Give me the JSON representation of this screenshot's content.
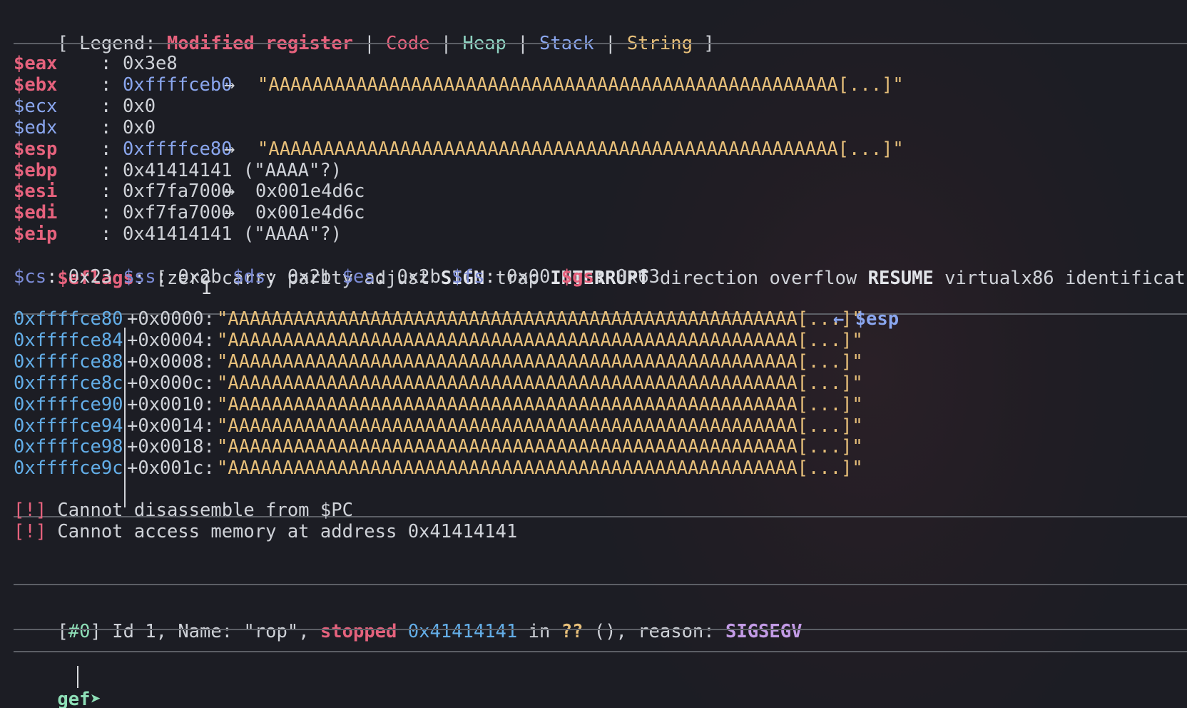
{
  "legend": {
    "open": "[ Legend: ",
    "modified": "Modified register",
    "sep": " | ",
    "code": "Code",
    "heap": "Heap",
    "stack": "Stack",
    "string": "String",
    "close": " ]"
  },
  "registers": [
    {
      "name": "$eax",
      "modified": true,
      "value": "0x3e8",
      "value_color": "plain",
      "arrow": "",
      "deref": "",
      "deref_color": ""
    },
    {
      "name": "$ebx",
      "modified": true,
      "value": "0xffffceb0",
      "value_color": "stack",
      "arrow": "→",
      "deref": "\"AAAAAAAAAAAAAAAAAAAAAAAAAAAAAAAAAAAAAAAAAAAAAAAAAAAA[...]\"",
      "deref_color": "string"
    },
    {
      "name": "$ecx",
      "modified": false,
      "value": "0x0",
      "value_color": "plain",
      "arrow": "",
      "deref": "",
      "deref_color": ""
    },
    {
      "name": "$edx",
      "modified": false,
      "value": "0x0",
      "value_color": "plain",
      "arrow": "",
      "deref": "",
      "deref_color": ""
    },
    {
      "name": "$esp",
      "modified": true,
      "value": "0xffffce80",
      "value_color": "stack",
      "arrow": "→",
      "deref": "\"AAAAAAAAAAAAAAAAAAAAAAAAAAAAAAAAAAAAAAAAAAAAAAAAAAAA[...]\"",
      "deref_color": "string"
    },
    {
      "name": "$ebp",
      "modified": true,
      "value": "0x41414141 (\"AAAA\"?)",
      "value_color": "plain",
      "arrow": "",
      "deref": "",
      "deref_color": ""
    },
    {
      "name": "$esi",
      "modified": true,
      "value": "0xf7fa7000",
      "value_color": "plain",
      "arrow": "→",
      "deref": "0x001e4d6c",
      "deref_color": "plain"
    },
    {
      "name": "$edi",
      "modified": true,
      "value": "0xf7fa7000",
      "value_color": "plain",
      "arrow": "→",
      "deref": "0x001e4d6c",
      "deref_color": "plain"
    },
    {
      "name": "$eip",
      "modified": true,
      "value": "0x41414141 (\"AAAA\"?)",
      "value_color": "plain",
      "arrow": "",
      "deref": "",
      "deref_color": ""
    }
  ],
  "colon": ":",
  "eflags": {
    "name": "$eflags",
    "open": "[",
    "flags": [
      {
        "text": "zero",
        "set": false
      },
      {
        "text": "carry",
        "set": false
      },
      {
        "text": "parity",
        "set": false
      },
      {
        "text": "adjust",
        "set": false
      },
      {
        "text": "SIGN",
        "set": true
      },
      {
        "text": "trap",
        "set": false
      },
      {
        "text": "INTERRUPT",
        "set": true
      },
      {
        "text": "direction",
        "set": false
      },
      {
        "text": "overflow",
        "set": false
      },
      {
        "text": "RESUME",
        "set": true
      },
      {
        "text": "virtualx86",
        "set": false
      },
      {
        "text": "identification",
        "set": false
      }
    ],
    "close": "]"
  },
  "segments": [
    {
      "name": "$cs",
      "value": "0x23",
      "modified": false
    },
    {
      "name": "$ss",
      "value": "0x2b",
      "modified": false
    },
    {
      "name": "$ds",
      "value": "0x2b",
      "modified": false
    },
    {
      "name": "$es",
      "value": "0x2b",
      "modified": false
    },
    {
      "name": "$fs",
      "value": "0x00",
      "modified": false
    },
    {
      "name": "$gs",
      "value": "0x63",
      "modified": true
    }
  ],
  "stack": [
    {
      "addr": "0xffffce80",
      "offset": "+0x0000:",
      "value": "\"AAAAAAAAAAAAAAAAAAAAAAAAAAAAAAAAAAAAAAAAAAAAAAAAAAAA[...]\"",
      "marker": "← $esp"
    },
    {
      "addr": "0xffffce84",
      "offset": "+0x0004:",
      "value": "\"AAAAAAAAAAAAAAAAAAAAAAAAAAAAAAAAAAAAAAAAAAAAAAAAAAAA[...]\"",
      "marker": ""
    },
    {
      "addr": "0xffffce88",
      "offset": "+0x0008:",
      "value": "\"AAAAAAAAAAAAAAAAAAAAAAAAAAAAAAAAAAAAAAAAAAAAAAAAAAAA[...]\"",
      "marker": ""
    },
    {
      "addr": "0xffffce8c",
      "offset": "+0x000c:",
      "value": "\"AAAAAAAAAAAAAAAAAAAAAAAAAAAAAAAAAAAAAAAAAAAAAAAAAAAA[...]\"",
      "marker": ""
    },
    {
      "addr": "0xffffce90",
      "offset": "+0x0010:",
      "value": "\"AAAAAAAAAAAAAAAAAAAAAAAAAAAAAAAAAAAAAAAAAAAAAAAAAAAA[...]\"",
      "marker": ""
    },
    {
      "addr": "0xffffce94",
      "offset": "+0x0014:",
      "value": "\"AAAAAAAAAAAAAAAAAAAAAAAAAAAAAAAAAAAAAAAAAAAAAAAAAAAA[...]\"",
      "marker": ""
    },
    {
      "addr": "0xffffce98",
      "offset": "+0x0018:",
      "value": "\"AAAAAAAAAAAAAAAAAAAAAAAAAAAAAAAAAAAAAAAAAAAAAAAAAAAA[...]\"",
      "marker": ""
    },
    {
      "addr": "0xffffce9c",
      "offset": "+0x001c:",
      "value": "\"AAAAAAAAAAAAAAAAAAAAAAAAAAAAAAAAAAAAAAAAAAAAAAAAAAAA[...]\"",
      "marker": ""
    }
  ],
  "errors": [
    {
      "tag": "[!]",
      "text": " Cannot disassemble from $PC"
    },
    {
      "tag": "[!]",
      "text": " Cannot access memory at address 0x41414141"
    }
  ],
  "thread": {
    "open": "[",
    "num": "#0",
    "close": "]",
    "text1": " Id 1, Name: \"rop\", ",
    "stopped": "stopped",
    "space": " ",
    "addr": "0x41414141",
    "in": " in ",
    "qq": "??",
    "text2": " (), reason: ",
    "reason": "SIGSEGV"
  },
  "prompt": "gef➤",
  "colors": {
    "modified": "#e6627d",
    "code": "#e6627d",
    "heap": "#8fd3c2",
    "stack": "#8aa6ee",
    "string": "#e8c07a",
    "background": "#1c1d24"
  }
}
